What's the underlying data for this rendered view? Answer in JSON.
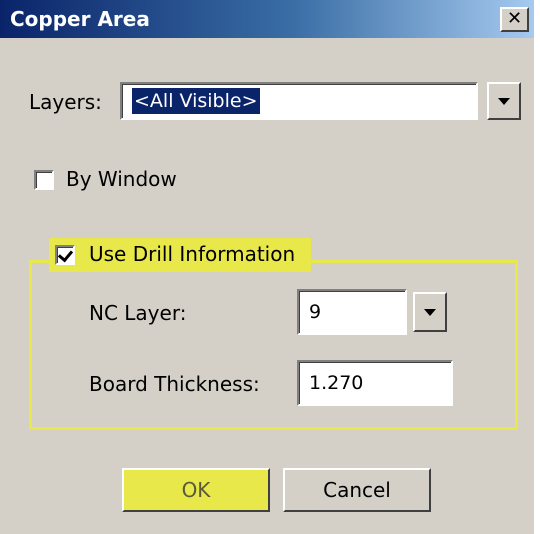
{
  "window": {
    "title": "Copper  Area",
    "close_glyph": "✕"
  },
  "layers": {
    "label": "Layers:",
    "value": "<All Visible>"
  },
  "by_window": {
    "label": "By Window",
    "checked": false
  },
  "drill": {
    "label": "Use Drill Information",
    "checked": true,
    "nc_layer_label": "NC Layer:",
    "nc_layer_value": "9",
    "board_thickness_label": "Board Thickness:",
    "board_thickness_value": "1.270"
  },
  "buttons": {
    "ok": "OK",
    "cancel": "Cancel"
  },
  "colors": {
    "dialog_face": "#d4d0c8",
    "title_active": "#0a246a",
    "highlight_yellow": "#e8e84a",
    "selection_blue": "#0a246a"
  },
  "icons": {
    "close": "close-icon",
    "dropdown": "chevron-down-icon",
    "check": "checkmark-icon"
  }
}
